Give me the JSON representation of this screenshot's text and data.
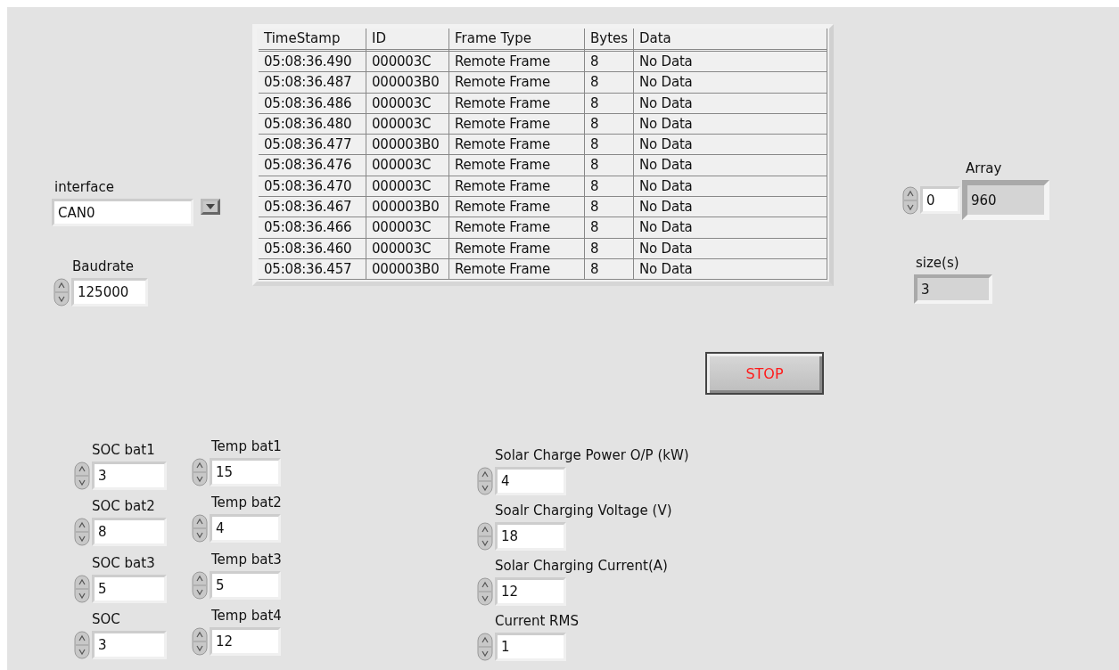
{
  "table": {
    "columns": [
      "TimeStamp",
      "ID",
      "Frame Type",
      "Bytes",
      "Data"
    ],
    "rows": [
      [
        "05:08:36.490",
        "000003C",
        "Remote Frame",
        "8",
        "No Data"
      ],
      [
        "05:08:36.487",
        "000003B0",
        "Remote Frame",
        "8",
        "No Data"
      ],
      [
        "05:08:36.486",
        "000003C",
        "Remote Frame",
        "8",
        "No Data"
      ],
      [
        "05:08:36.480",
        "000003C",
        "Remote Frame",
        "8",
        "No Data"
      ],
      [
        "05:08:36.477",
        "000003B0",
        "Remote Frame",
        "8",
        "No Data"
      ],
      [
        "05:08:36.476",
        "000003C",
        "Remote Frame",
        "8",
        "No Data"
      ],
      [
        "05:08:36.470",
        "000003C",
        "Remote Frame",
        "8",
        "No Data"
      ],
      [
        "05:08:36.467",
        "000003B0",
        "Remote Frame",
        "8",
        "No Data"
      ],
      [
        "05:08:36.466",
        "000003C",
        "Remote Frame",
        "8",
        "No Data"
      ],
      [
        "05:08:36.460",
        "000003C",
        "Remote Frame",
        "8",
        "No Data"
      ],
      [
        "05:08:36.457",
        "000003B0",
        "Remote Frame",
        "8",
        "No Data"
      ]
    ]
  },
  "interface": {
    "label": "interface",
    "value": "CAN0"
  },
  "baudrate": {
    "label": "Baudrate",
    "value": "125000"
  },
  "array": {
    "label": "Array",
    "index": "0",
    "value": "960"
  },
  "size": {
    "label": "size(s)",
    "value": "3"
  },
  "stop_button": {
    "label": "STOP"
  },
  "soc_controls": [
    {
      "label": "SOC bat1",
      "value": "3"
    },
    {
      "label": "SOC bat2",
      "value": "8"
    },
    {
      "label": "SOC bat3",
      "value": "5"
    },
    {
      "label": "SOC",
      "value": "3"
    }
  ],
  "temp_controls": [
    {
      "label": "Temp bat1",
      "value": "15"
    },
    {
      "label": "Temp bat2",
      "value": "4"
    },
    {
      "label": "Temp bat3",
      "value": "5"
    },
    {
      "label": "Temp bat4",
      "value": "12"
    }
  ],
  "solar_controls": [
    {
      "label": "Solar Charge Power O/P (kW)",
      "value": "4"
    },
    {
      "label": "Soalr Charging Voltage (V)",
      "value": "18"
    },
    {
      "label": "Solar Charging Current(A)",
      "value": "12"
    },
    {
      "label": "Current RMS",
      "value": "1"
    }
  ]
}
